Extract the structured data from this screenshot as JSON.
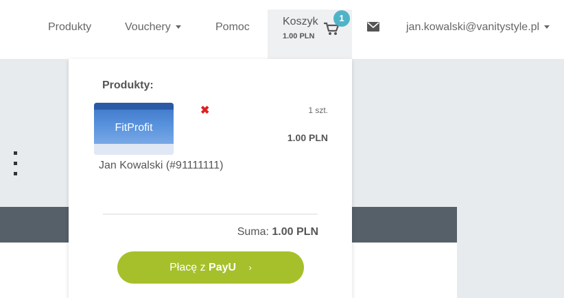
{
  "nav": {
    "products": "Produkty",
    "vouchers": "Vouchery",
    "help": "Pomoc",
    "cart_label": "Koszyk",
    "cart_total": "1.00 PLN",
    "cart_count": "1",
    "user_email": "jan.kowalski@vanitystyle.pl"
  },
  "cart": {
    "heading": "Produkty:",
    "item": {
      "image_brand": "FitProfit",
      "quantity": "1 szt.",
      "price": "1.00 PLN",
      "owner": "Jan Kowalski (#91111111)"
    },
    "sum_label": "Suma:",
    "sum_value": "1.00 PLN",
    "pay_prefix": "Płacę z",
    "pay_brand": "PayU",
    "pay_arrow": "›"
  },
  "colors": {
    "accent": "#a6c02b",
    "badge": "#4fb3c8",
    "remove": "#e02020",
    "dark_band": "#566068"
  },
  "icons": [
    "caret-down-icon",
    "cart-icon",
    "mail-icon",
    "close-icon",
    "chevron-right-icon"
  ]
}
